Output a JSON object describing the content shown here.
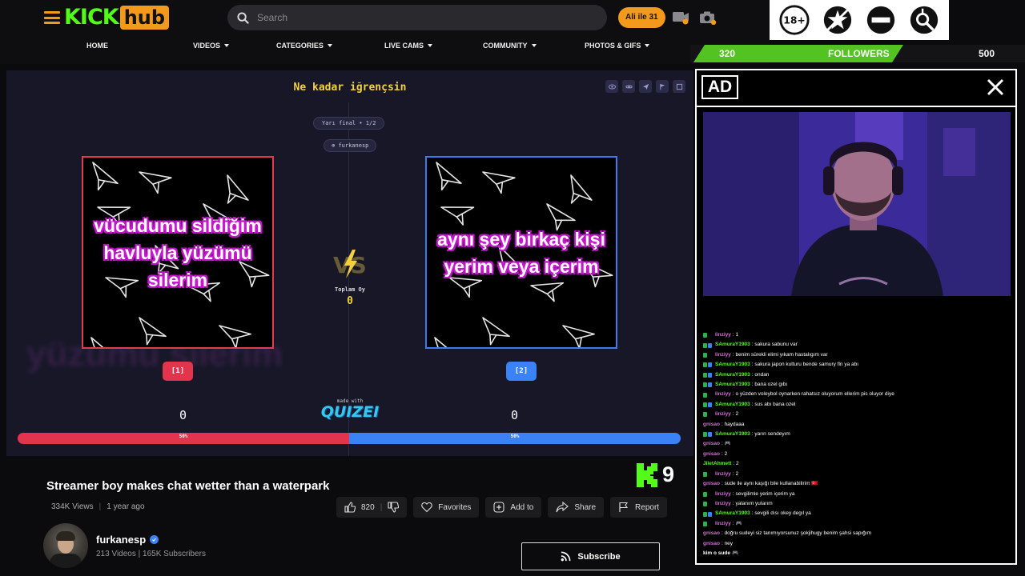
{
  "header": {
    "logo_kick": "KICK",
    "logo_hub": "hub",
    "search_placeholder": "Search",
    "user_pill": "Ali ile 31",
    "nav": [
      {
        "label": "HOME",
        "caret": false
      },
      {
        "label": "VIDEOS",
        "caret": true
      },
      {
        "label": "CATEGORIES",
        "caret": true
      },
      {
        "label": "LIVE CAMS",
        "caret": true
      },
      {
        "label": "COMMUNITY",
        "caret": true
      },
      {
        "label": "PHOTOS & GIFS",
        "caret": true
      }
    ],
    "badges": [
      {
        "icon": "18-plus-icon",
        "text": "18+"
      },
      {
        "icon": "crossed-spray-icon",
        "text": ""
      },
      {
        "icon": "no-entry-icon",
        "text": ""
      },
      {
        "icon": "gender-search-icon",
        "text": ""
      }
    ]
  },
  "followers": {
    "current": "320",
    "label": "FOLLOWERS",
    "goal": "500",
    "progress": 0.64
  },
  "quiz": {
    "title": "Ne kadar iğrençsin",
    "round": "Yarı final • 1/2",
    "author": "furkanesp",
    "left_option": "vücudumu sildiğim havluyla yüzümü silerim",
    "right_option": "aynı şey birkaç kişi yerim veya içerim",
    "total_label": "Toplam Oy",
    "total_value": "0",
    "left_button": "[1]",
    "right_button": "[2]",
    "left_score": "0",
    "right_score": "0",
    "made_with": "made with",
    "brand": "QUIZEI",
    "left_percent_label": "50%",
    "right_percent_label": "50%",
    "left_share": 50,
    "colors": {
      "left": "#e2344c",
      "right": "#3b82f6",
      "title": "#f4d03f"
    }
  },
  "video": {
    "title": "Streamer boy makes chat wetter than a waterpark",
    "views": "334K Views",
    "age": "1 year ago",
    "likes": "820",
    "favorites": "Favorites",
    "add_to": "Add to",
    "share": "Share",
    "report": "Report",
    "k_count": "9"
  },
  "channel": {
    "name": "furkanesp",
    "stats": "213 Videos | 165K Subscribers",
    "subscribe": "Subscribe"
  },
  "ad": {
    "label": "AD"
  },
  "chat": [
    {
      "user": "linziyy",
      "text": ": 1",
      "color": "#d46fd8",
      "icons": [
        "#29b34a"
      ]
    },
    {
      "user": "SAmuraY1903",
      "text": ": sakura sabunu var",
      "color": "#53fc18",
      "icons": [
        "#29b34a",
        "#3b82f6"
      ]
    },
    {
      "user": "linziyy",
      "text": ": benim sürekli elimi yıkam hastalıgım var",
      "color": "#d46fd8",
      "icons": [
        "#29b34a"
      ]
    },
    {
      "user": "SAmuraY1903",
      "text": ": sakura japon kulturu bende samury fln ya abı",
      "color": "#53fc18",
      "icons": [
        "#29b34a",
        "#3b82f6"
      ]
    },
    {
      "user": "SAmuraY1903",
      "text": ": ondan",
      "color": "#53fc18",
      "icons": [
        "#29b34a",
        "#3b82f6"
      ]
    },
    {
      "user": "SAmuraY1903",
      "text": ": bana ozel gıbı",
      "color": "#53fc18",
      "icons": [
        "#29b34a",
        "#3b82f6"
      ]
    },
    {
      "user": "linziyy",
      "text": ": o yüzden voleybol oynarken rahatsız oluyorum ellerim pis oluyor diye",
      "color": "#d46fd8",
      "icons": [
        "#29b34a"
      ]
    },
    {
      "user": "SAmuraY1903",
      "text": ": sus abı bana ozel",
      "color": "#53fc18",
      "icons": [
        "#29b34a",
        "#3b82f6"
      ]
    },
    {
      "user": "linziyy",
      "text": ": 2",
      "color": "#d46fd8",
      "icons": [
        "#29b34a"
      ]
    },
    {
      "user": "gnisao",
      "text": ": haydaaa",
      "color": "#d46fd8",
      "icons": []
    },
    {
      "user": "SAmuraY1903",
      "text": ": yarın sendeyım",
      "color": "#53fc18",
      "icons": [
        "#29b34a",
        "#3b82f6"
      ]
    },
    {
      "user": "gnisao",
      "text": ": 🎮",
      "color": "#d46fd8",
      "icons": []
    },
    {
      "user": "gnisao",
      "text": ": 2",
      "color": "#d46fd8",
      "icons": []
    },
    {
      "user": "JiletAhmett",
      "text": ": 2",
      "color": "#53fc18",
      "icons": []
    },
    {
      "user": "linziyy",
      "text": ": 2",
      "color": "#d46fd8",
      "icons": [
        "#29b34a"
      ]
    },
    {
      "user": "gnisao",
      "text": ": sude ile aynı kaşığı bile kullanabilirim 🇹🇷",
      "color": "#d46fd8",
      "icons": []
    },
    {
      "user": "linziyy",
      "text": ": sevgilimle yerim içerim ya",
      "color": "#d46fd8",
      "icons": [
        "#29b34a"
      ]
    },
    {
      "user": "linziyy",
      "text": ": yalanım yutarım",
      "color": "#d46fd8",
      "icons": [
        "#29b34a"
      ]
    },
    {
      "user": "SAmuraY1903",
      "text": ": sevgili dısı okey degıl ya",
      "color": "#53fc18",
      "icons": [
        "#29b34a",
        "#3b82f6"
      ]
    },
    {
      "user": "linziyy",
      "text": ": 🎮",
      "color": "#d46fd8",
      "icons": [
        "#29b34a"
      ]
    },
    {
      "user": "gnisao",
      "text": ": doğru sudeyi siz tanımıyorsunuz şokjihugy benim şahsi sapığım",
      "color": "#d46fd8",
      "icons": []
    },
    {
      "user": "gnisao",
      "text": ": ney",
      "color": "#d46fd8",
      "icons": []
    },
    {
      "user": "kim o sude",
      "text": "🎮",
      "color": "#ffffff",
      "icons": []
    }
  ]
}
